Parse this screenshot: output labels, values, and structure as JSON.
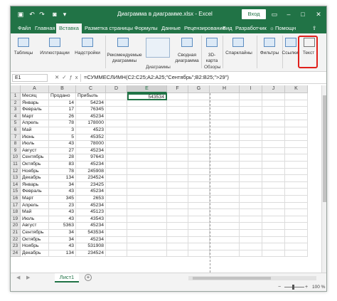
{
  "title_bar": {
    "title": "Диаграмма в диаграмме.xlsx  -  Excel",
    "login_label": "Вход",
    "save_icon": "save-icon",
    "undo_icon": "undo-icon",
    "redo_icon": "redo-icon",
    "camera_icon": "camera-icon",
    "customize_icon": "customize-icon",
    "ribbon_display_icon": "ribbon-display-icon",
    "minimize_icon": "minimize-icon",
    "maximize_icon": "maximize-icon",
    "close_icon": "close-icon",
    "accent_color": "#217346"
  },
  "tabs": {
    "file": "Файл",
    "home": "Главная",
    "insert": "Вставка",
    "page_layout": "Разметка страницы",
    "formulas": "Формулы",
    "data": "Данные",
    "review": "Рецензирование",
    "view": "Вид",
    "developer": "Разработчик",
    "tell_me_icon": "lightbulb-icon",
    "help": "Помощн",
    "share_icon": "share-icon"
  },
  "ribbon": {
    "tables": "Таблицы",
    "illustrations": "Иллюстрации",
    "addins": "Надстройки",
    "recommended_charts_1": "Рекомендуемые",
    "recommended_charts_2": "диаграммы",
    "pivot_chart_1": "Сводная",
    "pivot_chart_2": "диаграмма",
    "map_3d_1": "3D-",
    "map_3d_2": "карта",
    "sparklines": "Спарклайны",
    "filters": "Фильтры",
    "links": "Ссылки",
    "text": "Текст",
    "group_charts": "Диаграммы",
    "group_tours": "Обзоры"
  },
  "formula_bar": {
    "name_box": "E1",
    "formula": "=СУММЕСЛИМН(C2:C25;A2:A25;\"Сентябрь\";B2:B25;\">29\")"
  },
  "grid": {
    "columns": [
      "A",
      "B",
      "C",
      "D",
      "E",
      "F",
      "G",
      "H",
      "I",
      "J",
      "K"
    ],
    "headers": [
      "Месяц",
      "Продано",
      "Прибыль"
    ],
    "rows": [
      [
        "Январь",
        "14",
        "54234"
      ],
      [
        "Февраль",
        "17",
        "76345"
      ],
      [
        "Март",
        "26",
        "45234"
      ],
      [
        "Апрель",
        "78",
        "178000"
      ],
      [
        "Май",
        "3",
        "4523"
      ],
      [
        "Июнь",
        "5",
        "45352"
      ],
      [
        "Июль",
        "43",
        "78000"
      ],
      [
        "Август",
        "27",
        "45234"
      ],
      [
        "Сентябрь",
        "28",
        "97643"
      ],
      [
        "Октябрь",
        "83",
        "45234"
      ],
      [
        "Ноябрь",
        "78",
        "245908"
      ],
      [
        "Декабрь",
        "134",
        "234524"
      ],
      [
        "Январь",
        "34",
        "23425"
      ],
      [
        "Февраль",
        "43",
        "45234"
      ],
      [
        "Март",
        "345",
        "2653"
      ],
      [
        "Апрель",
        "23",
        "45234"
      ],
      [
        "Май",
        "43",
        "45123"
      ],
      [
        "Июль",
        "43",
        "43543"
      ],
      [
        "Август",
        "5363",
        "45234"
      ],
      [
        "Сентябрь",
        "34",
        "543534"
      ],
      [
        "Октябрь",
        "34",
        "45234"
      ],
      [
        "Ноябрь",
        "43",
        "531908"
      ],
      [
        "Декабрь",
        "134",
        "234524"
      ]
    ],
    "e1_value": "543534"
  },
  "sheets": {
    "active": "Лист1",
    "add_icon": "plus-icon"
  },
  "status": {
    "zoom_minus": "−",
    "zoom_plus": "+",
    "zoom_value": "100 %",
    "zoom_level": 1.0
  }
}
